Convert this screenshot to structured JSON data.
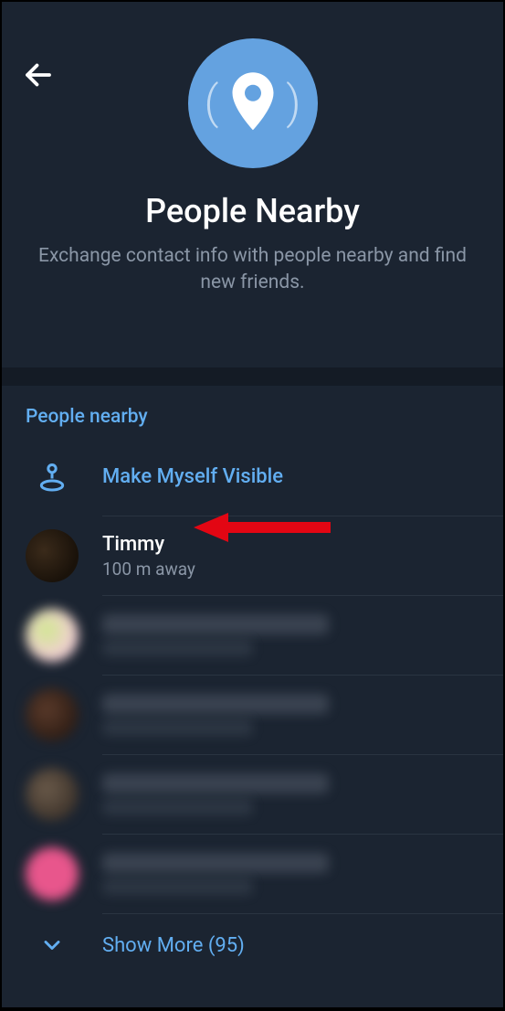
{
  "header": {
    "title": "People Nearby",
    "subtitle": "Exchange contact info with people nearby and find new friends."
  },
  "section": {
    "header": "People nearby",
    "visibility_action": "Make Myself Visible",
    "show_more_label": "Show More (95)"
  },
  "people": [
    {
      "name": "Timmy",
      "distance": "100 m away",
      "blurred": false
    },
    {
      "name": "—",
      "distance": "—",
      "blurred": true
    },
    {
      "name": "—",
      "distance": "—",
      "blurred": true
    },
    {
      "name": "—",
      "distance": "—",
      "blurred": true
    },
    {
      "name": "—",
      "distance": "—",
      "blurred": true
    }
  ],
  "colors": {
    "accent": "#62aef1",
    "hero_bg": "#64a2e0",
    "bg": "#1b2431",
    "gap": "#141b25"
  }
}
